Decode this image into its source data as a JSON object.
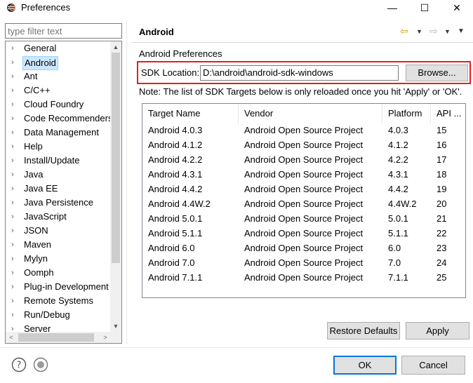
{
  "window": {
    "title": "Preferences",
    "icon": "eclipse-icon",
    "controls": {
      "minimize": "—",
      "maximize": "☐",
      "close": "✕"
    }
  },
  "sidebar": {
    "filter_placeholder": "type filter text",
    "items": [
      {
        "label": "General",
        "selected": false
      },
      {
        "label": "Android",
        "selected": true
      },
      {
        "label": "Ant",
        "selected": false
      },
      {
        "label": "C/C++",
        "selected": false
      },
      {
        "label": "Cloud Foundry",
        "selected": false
      },
      {
        "label": "Code Recommenders",
        "selected": false
      },
      {
        "label": "Data Management",
        "selected": false
      },
      {
        "label": "Help",
        "selected": false
      },
      {
        "label": "Install/Update",
        "selected": false
      },
      {
        "label": "Java",
        "selected": false
      },
      {
        "label": "Java EE",
        "selected": false
      },
      {
        "label": "Java Persistence",
        "selected": false
      },
      {
        "label": "JavaScript",
        "selected": false
      },
      {
        "label": "JSON",
        "selected": false
      },
      {
        "label": "Maven",
        "selected": false
      },
      {
        "label": "Mylyn",
        "selected": false
      },
      {
        "label": "Oomph",
        "selected": false
      },
      {
        "label": "Plug-in Development",
        "selected": false
      },
      {
        "label": "Remote Systems",
        "selected": false
      },
      {
        "label": "Run/Debug",
        "selected": false
      },
      {
        "label": "Server",
        "selected": false
      }
    ]
  },
  "page": {
    "title": "Android",
    "section_label": "Android Preferences",
    "sdk_location_label": "SDK Location:",
    "sdk_location_value": "D:\\android\\android-sdk-windows",
    "browse_label": "Browse...",
    "note": "Note: The list of SDK Targets below is only reloaded once you hit 'Apply' or 'OK'.",
    "highlight_color": "#e02020"
  },
  "targets": {
    "columns": [
      "Target Name",
      "Vendor",
      "Platform",
      "API ..."
    ],
    "rows": [
      [
        "Android 4.0.3",
        "Android Open Source Project",
        "4.0.3",
        "15"
      ],
      [
        "Android 4.1.2",
        "Android Open Source Project",
        "4.1.2",
        "16"
      ],
      [
        "Android 4.2.2",
        "Android Open Source Project",
        "4.2.2",
        "17"
      ],
      [
        "Android 4.3.1",
        "Android Open Source Project",
        "4.3.1",
        "18"
      ],
      [
        "Android 4.4.2",
        "Android Open Source Project",
        "4.4.2",
        "19"
      ],
      [
        "Android 4.4W.2",
        "Android Open Source Project",
        "4.4W.2",
        "20"
      ],
      [
        "Android 5.0.1",
        "Android Open Source Project",
        "5.0.1",
        "21"
      ],
      [
        "Android 5.1.1",
        "Android Open Source Project",
        "5.1.1",
        "22"
      ],
      [
        "Android 6.0",
        "Android Open Source Project",
        "6.0",
        "23"
      ],
      [
        "Android 7.0",
        "Android Open Source Project",
        "7.0",
        "24"
      ],
      [
        "Android 7.1.1",
        "Android Open Source Project",
        "7.1.1",
        "25"
      ]
    ]
  },
  "actions": {
    "restore_defaults": "Restore Defaults",
    "apply": "Apply",
    "ok": "OK",
    "cancel": "Cancel"
  },
  "footer": {
    "help_icon": "help-icon",
    "record_icon": "record-icon"
  }
}
